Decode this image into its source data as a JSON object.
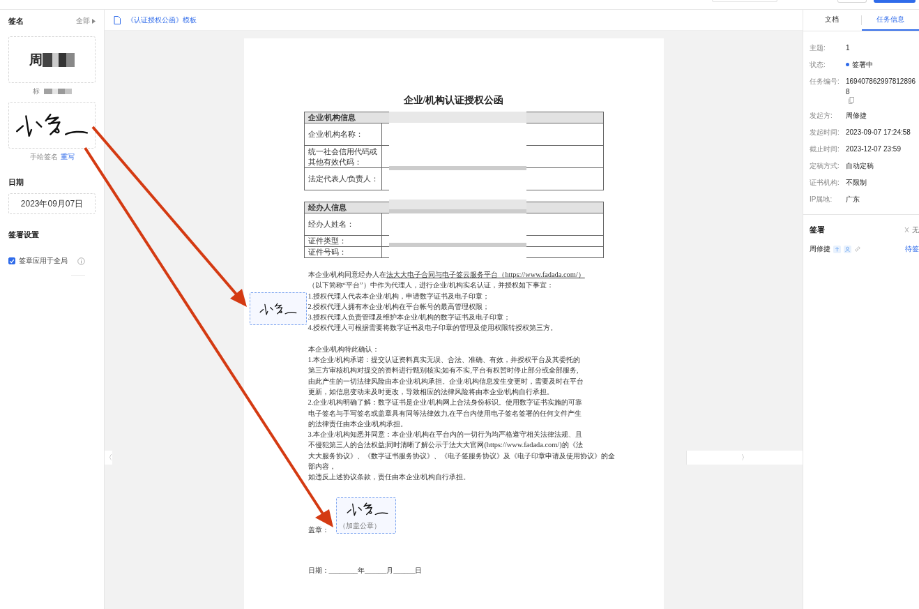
{
  "sidebar": {
    "title": "签名",
    "all_link": "全部",
    "signatures": [
      {
        "kind": "typed",
        "glyph": "周",
        "caption": "标"
      },
      {
        "kind": "drawn",
        "caption": "手绘签名",
        "action": "重写"
      }
    ],
    "date_title": "日期",
    "date_value": "2023年09月07日",
    "settings_title": "签署设置",
    "settings": [
      {
        "label": "签章应用于全局",
        "checked": true
      }
    ]
  },
  "breadcrumb": "《认证授权公函》模板",
  "collapse_left": "〈",
  "collapse_right": "〉",
  "document": {
    "title": "企业/机构认证授权公函",
    "tables": [
      {
        "header": "企业/机构信息",
        "rows": [
          {
            "label": "企业/机构名称：",
            "kind": "double"
          },
          {
            "label": "统一社会信用代码或其他有效代码：",
            "kind": "double"
          },
          {
            "label": "法定代表人/负责人：",
            "kind": "double"
          }
        ]
      },
      {
        "header": "经办人信息",
        "rows": [
          {
            "label": "经办人姓名：",
            "kind": "double"
          },
          {
            "label": "证件类型：",
            "kind": "single"
          },
          {
            "label": "证件号码：",
            "kind": "single"
          }
        ]
      }
    ],
    "intro_before": "本企业/机构同意经办人在",
    "intro_link": "法大大电子合同与电子签云服务平台（https://www.fadada.com/）",
    "intro_after": "（以下简称“平台”）中作为代理人，进行企业/机构实名认证，并授权如下事宜：",
    "authorizations": [
      "1.授权代理人代表本企业/机构，申请数字证书及电子印章；",
      "2.授权代理人拥有本企业/机构在平台帐号的最高管理权限；",
      "3.授权代理人负责管理及维护本企业/机构的数字证书及电子印章；",
      "4.授权代理人可根据需要将数字证书及电子印章的管理及使用权限转授权第三方。"
    ],
    "confirm_title": "本企业/机构特此确认：",
    "clauses": [
      [
        "1.本企业/机构承诺：提交认证资料真实无误、合法、准确、有效，并授权平台及其委托的",
        "第三方审核机构对提交的资料进行甄别核实;如有不实,平台有权暂时停止部分或全部服务,",
        "由此产生的一切法律风险由本企业/机构承担。企业/机构信息发生变更时，需要及时在平台",
        "更新，如信息变动未及时更改，导致相应的法律风险将由本企业/机构自行承担。"
      ],
      [
        "2.企业/机构明确了解：数字证书是企业/机构网上合法身份标识。使用数字证书实施的可靠",
        "电子签名与手写签名或盖章具有同等法律效力,在平台内使用电子签名签署的任何文件产生",
        "的法律责任由本企业/机构承担。"
      ],
      [
        "3.本企业/机构知悉并同意：本企业/机构在平台内的一切行为均严格遵守相关法律法规、且",
        "不侵犯第三人的合法权益;同时清晰了解公示于法大大官网(https://www.fadada.com/)的《法",
        "大大服务协议》、《数字证书服务协议》、《电子签服务协议》及《电子印章申请及使用协议》的全",
        "部内容，"
      ],
      [
        "如违反上述协议条款，责任由本企业/机构自行承担。"
      ]
    ],
    "seal_label": "盖章：",
    "seal_hint": "（加盖公章）",
    "date_line": "日期：________年______月______日"
  },
  "right_panel": {
    "tabs": [
      {
        "label": "文档",
        "selected": false
      },
      {
        "label": "任务信息",
        "selected": true
      }
    ],
    "info": [
      {
        "label": "主题:",
        "value": "1",
        "kind": "text"
      },
      {
        "label": "状态:",
        "value": "签署中",
        "kind": "status"
      },
      {
        "label": "任务编号:",
        "value": "1694078629978128968",
        "kind": "copy"
      },
      {
        "label": "发起方:",
        "value": "周修捷",
        "kind": "text"
      },
      {
        "label": "发起时间:",
        "value": "2023-09-07 17:24:58",
        "kind": "text"
      },
      {
        "label": "截止时间:",
        "value": "2023-12-07 23:59",
        "kind": "text"
      },
      {
        "label": "定稿方式:",
        "value": "自动定稿",
        "kind": "text"
      },
      {
        "label": "证书机构:",
        "value": "不限制",
        "kind": "text"
      },
      {
        "label": "IP属地:",
        "value": "广东",
        "kind": "text"
      }
    ],
    "signing_title": "签署",
    "order": "无",
    "signers": [
      {
        "name": "周修捷",
        "status": "待签"
      }
    ]
  }
}
